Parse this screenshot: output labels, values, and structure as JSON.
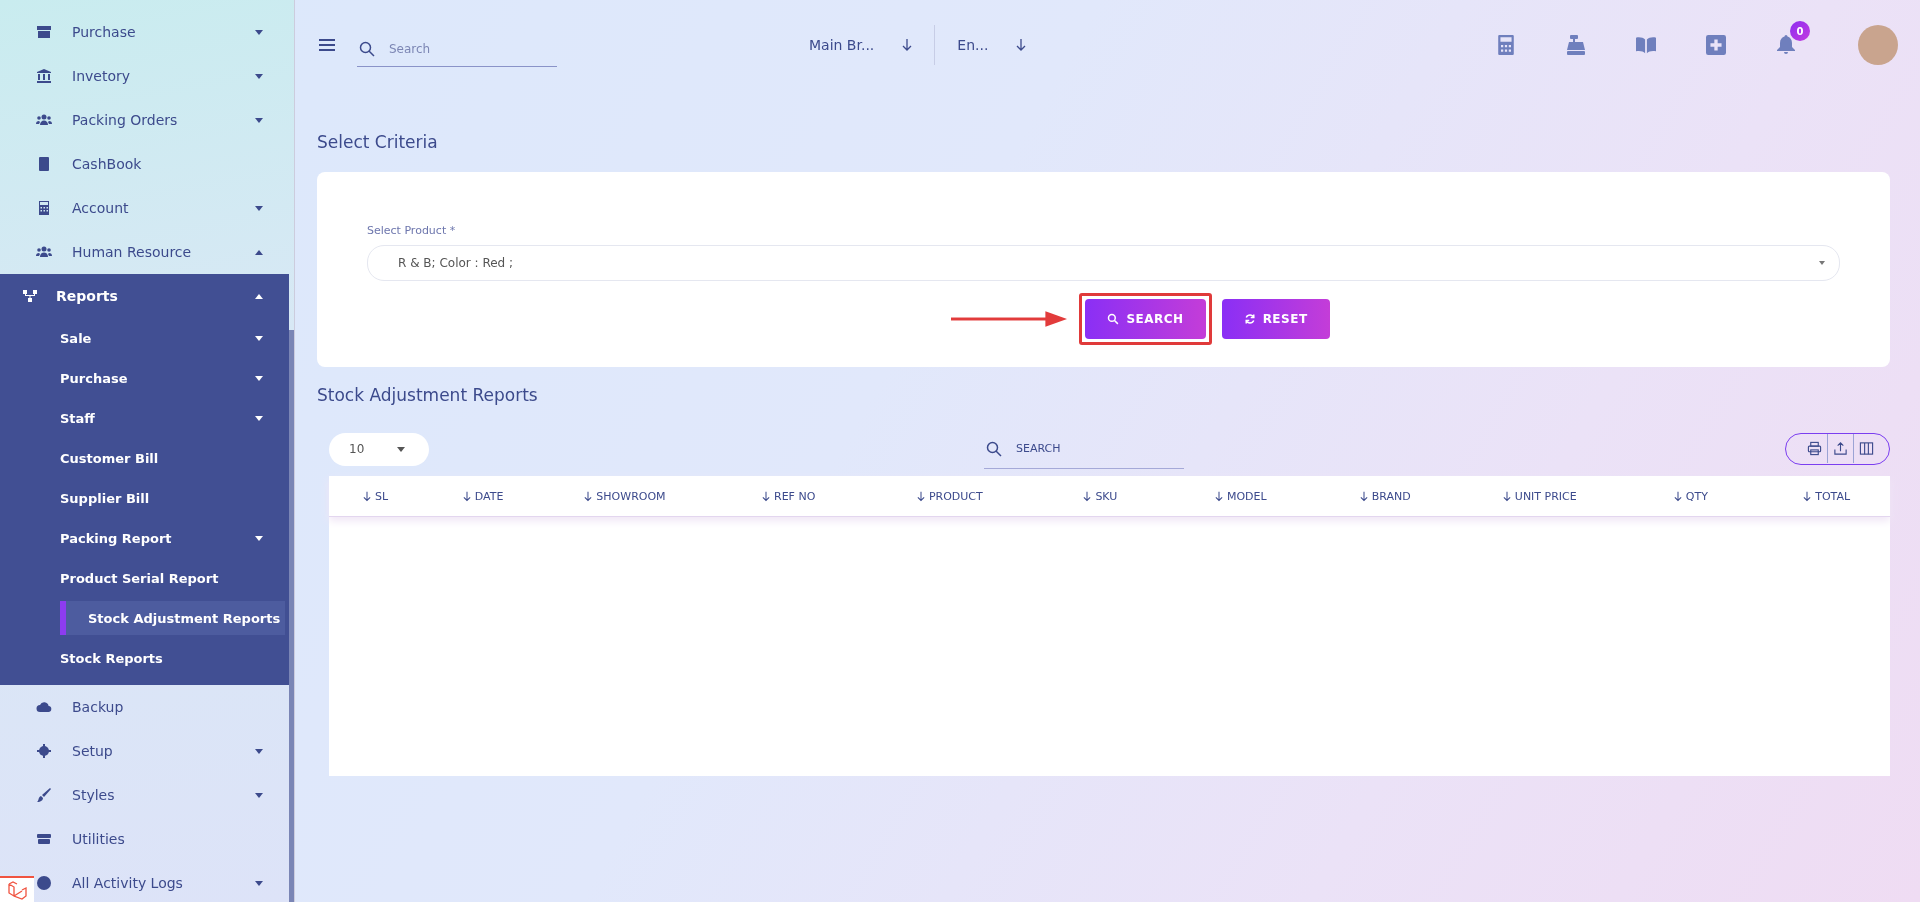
{
  "sidebar": {
    "items": [
      {
        "label": "Purchase",
        "has_children": true,
        "expanded": false
      },
      {
        "label": "Invetory",
        "has_children": true,
        "expanded": false
      },
      {
        "label": "Packing Orders",
        "has_children": true,
        "expanded": false
      },
      {
        "label": "CashBook",
        "has_children": false
      },
      {
        "label": "Account",
        "has_children": true,
        "expanded": false
      },
      {
        "label": "Human Resource",
        "has_children": true,
        "expanded": true
      },
      {
        "label": "Reports",
        "has_children": true,
        "expanded": true,
        "children": [
          {
            "label": "Sale",
            "has_children": true,
            "selected": false
          },
          {
            "label": "Purchase",
            "has_children": true,
            "selected": false
          },
          {
            "label": "Staff",
            "has_children": true,
            "selected": false
          },
          {
            "label": "Customer Bill",
            "has_children": false,
            "selected": false
          },
          {
            "label": "Supplier Bill",
            "has_children": false,
            "selected": false
          },
          {
            "label": "Packing Report",
            "has_children": true,
            "selected": false
          },
          {
            "label": "Product Serial Report",
            "has_children": false,
            "selected": false
          },
          {
            "label": "Stock Adjustment Reports",
            "has_children": false,
            "selected": true
          },
          {
            "label": "Stock Reports",
            "has_children": false,
            "selected": false
          }
        ]
      },
      {
        "label": "Backup",
        "has_children": false
      },
      {
        "label": "Setup",
        "has_children": true,
        "expanded": false
      },
      {
        "label": "Styles",
        "has_children": true,
        "expanded": false
      },
      {
        "label": "Utilities",
        "has_children": false
      },
      {
        "label": "All Activity Logs",
        "has_children": true,
        "expanded": false
      }
    ]
  },
  "header": {
    "search": {
      "placeholder": "Search"
    },
    "branch": "Main Br...",
    "language": "En...",
    "notifications": "0"
  },
  "criteria": {
    "title": "Select Criteria",
    "field_label": "Select Product *",
    "field_value": "R & B; Color : Red ;",
    "buttons": [
      {
        "label": "SEARCH",
        "kind": "search",
        "highlighted": true
      },
      {
        "label": "RESET",
        "kind": "reset",
        "highlighted": false
      }
    ]
  },
  "report": {
    "title": "Stock Adjustment Reports",
    "page_size": "10",
    "search": {
      "placeholder": "SEARCH"
    },
    "columns": [
      "SL",
      "DATE",
      "SHOWROOM",
      "REF NO",
      "PRODUCT",
      "SKU",
      "MODEL",
      "BRAND",
      "UNIT PRICE",
      "QTY",
      "TOTAL"
    ]
  }
}
